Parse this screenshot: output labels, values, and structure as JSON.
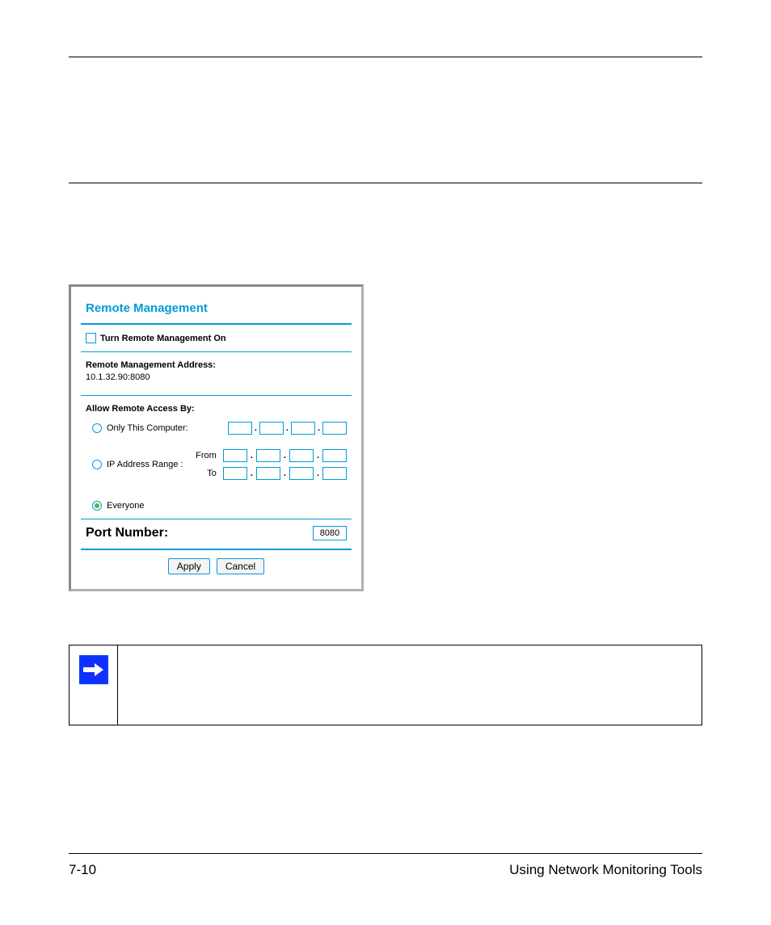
{
  "footer": {
    "page_number": "7-10",
    "section_title": "Using Network Monitoring Tools"
  },
  "panel": {
    "title": "Remote Management",
    "turn_on_label": "Turn Remote Management On",
    "address_label": "Remote Management Address:",
    "address_value": "10.1.32.90:8080",
    "allow_label": "Allow Remote Access By:",
    "only_this_label": "Only This Computer:",
    "range_label": "IP Address Range :",
    "from_label": "From",
    "to_label": "To",
    "everyone_label": "Everyone",
    "port_label": "Port Number:",
    "port_value": "8080",
    "apply_label": "Apply",
    "cancel_label": "Cancel"
  }
}
